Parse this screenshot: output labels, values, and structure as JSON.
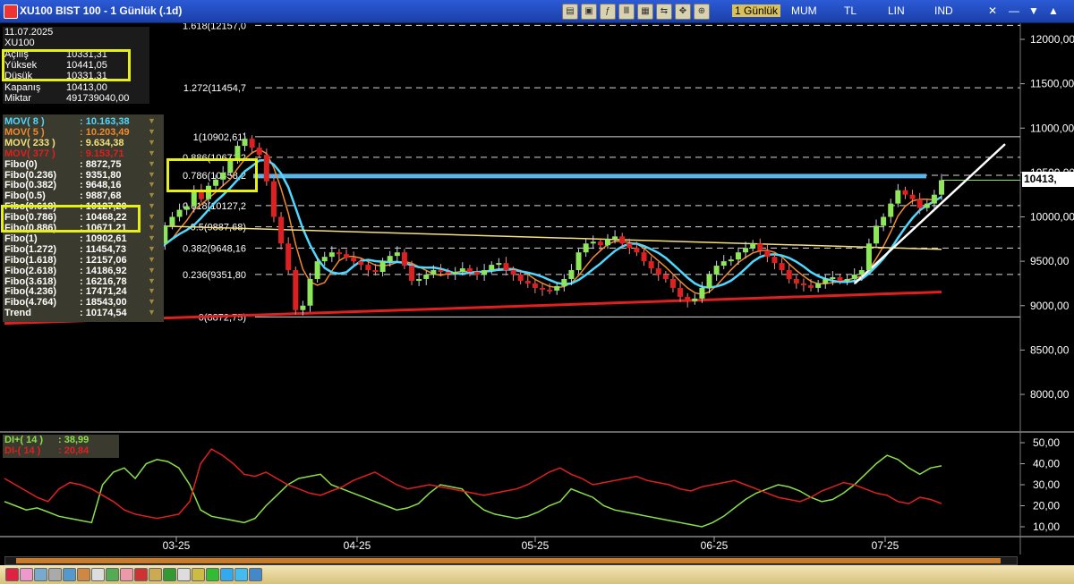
{
  "window": {
    "title": "XU100 BIST 100 - 1 Günlük (.1d)",
    "menu": [
      "1 Günlük",
      "MUM",
      "TL",
      "LIN",
      "IND"
    ],
    "selected_menu": "1 Günlük",
    "last_price_badge": "10413,"
  },
  "info": {
    "date": "11.07.2025",
    "symbol": "XU100",
    "rows": [
      {
        "label": "Açılış",
        "value": "10331,31"
      },
      {
        "label": "Yüksek",
        "value": "10441,05"
      },
      {
        "label": "Düşük",
        "value": "10331,31"
      },
      {
        "label": "Kapanış",
        "value": "10413,00"
      },
      {
        "label": "Miktar",
        "value": "491739040,00"
      }
    ]
  },
  "legend": [
    {
      "label": "MOV( 8 )",
      "value": ": 10.163,38",
      "color": "#4fd8ff"
    },
    {
      "label": "MOV( 5 )",
      "value": ": 10.203,49",
      "color": "#f08a2a"
    },
    {
      "label": "MOV( 233 )",
      "value": ": 9.634,38",
      "color": "#f5e07a"
    },
    {
      "label": "MOV( 377 )",
      "value": ": 9.153,71",
      "color": "#e02020"
    },
    {
      "label": "Fibo(0)",
      "value": ": 8872,75",
      "color": "#ffffff"
    },
    {
      "label": "Fibo(0.236)",
      "value": ": 9351,80",
      "color": "#ffffff"
    },
    {
      "label": "Fibo(0.382)",
      "value": ": 9648,16",
      "color": "#ffffff"
    },
    {
      "label": "Fibo(0.5)",
      "value": ": 9887,68",
      "color": "#ffffff"
    },
    {
      "label": "Fibo(0.618)",
      "value": ": 10127,20",
      "color": "#ffffff"
    },
    {
      "label": "Fibo(0.786)",
      "value": ": 10468,22",
      "color": "#ffffff"
    },
    {
      "label": "Fibo(0.886)",
      "value": ": 10671,21",
      "color": "#ffffff"
    },
    {
      "label": "Fibo(1)",
      "value": ": 10902,61",
      "color": "#ffffff"
    },
    {
      "label": "Fibo(1.272)",
      "value": ": 11454,73",
      "color": "#ffffff"
    },
    {
      "label": "Fibo(1.618)",
      "value": ": 12157,06",
      "color": "#ffffff"
    },
    {
      "label": "Fibo(2.618)",
      "value": ": 14186,92",
      "color": "#ffffff"
    },
    {
      "label": "Fibo(3.618)",
      "value": ": 16216,78",
      "color": "#ffffff"
    },
    {
      "label": "Fibo(4.236)",
      "value": ": 17471,24",
      "color": "#ffffff"
    },
    {
      "label": "Fibo(4.764)",
      "value": ": 18543,00",
      "color": "#ffffff"
    },
    {
      "label": "Trend",
      "value": ": 10174,54",
      "color": "#ffffff"
    }
  ],
  "di_legend": [
    {
      "label": "DI+( 14 )",
      "value": ": 38,99",
      "color": "#8be04a"
    },
    {
      "label": "DI-( 14 )",
      "value": ": 20,84",
      "color": "#e02020"
    }
  ],
  "chart_data": [
    {
      "type": "candlestick",
      "ylim": [
        7600,
        12160
      ],
      "y_ticks": [
        "12000,00",
        "11500,00",
        "11000,00",
        "10500,00",
        "10000,00",
        "9500,00",
        "9000,00",
        "8500,00",
        "8000,00"
      ],
      "x_ticks": [
        "03-25",
        "04-25",
        "05-25",
        "06-25",
        "07-25"
      ],
      "fib_levels": [
        {
          "label": "1.618(12157,0",
          "value": 12157
        },
        {
          "label": "1.272(11454,7",
          "value": 11454.7
        },
        {
          "label": "1(10902,61)",
          "value": 10902.61
        },
        {
          "label": "0.886(10671,2",
          "value": 10671.2
        },
        {
          "label": "0.786(10458,2",
          "value": 10468.2
        },
        {
          "label": "0.618(10127,2",
          "value": 10127.2
        },
        {
          "label": "0.5(9887,68)",
          "value": 9887.68
        },
        {
          "label": "0.382(9648,16",
          "value": 9648.16
        },
        {
          "label": "0.236(9351,80",
          "value": 9351.8
        },
        {
          "label": "0(8872,75)",
          "value": 8872.75
        }
      ],
      "close_series": [
        9540,
        9620,
        9700,
        9900,
        10000,
        10080,
        10120,
        10300,
        10200,
        10350,
        10420,
        10500,
        10650,
        10800,
        10880,
        10780,
        10700,
        10400,
        10000,
        9700,
        9400,
        8950,
        9000,
        9300,
        9500,
        9550,
        9600,
        9580,
        9540,
        9500,
        9460,
        9400,
        9380,
        9500,
        9560,
        9600,
        9450,
        9280,
        9300,
        9350,
        9400,
        9380,
        9360,
        9380,
        9420,
        9380,
        9350,
        9400,
        9460,
        9480,
        9400,
        9350,
        9280,
        9250,
        9200,
        9180,
        9170,
        9220,
        9300,
        9400,
        9600,
        9700,
        9720,
        9680,
        9750,
        9780,
        9700,
        9650,
        9600,
        9500,
        9420,
        9350,
        9300,
        9200,
        9100,
        9050,
        9080,
        9200,
        9350,
        9450,
        9500,
        9520,
        9600,
        9650,
        9700,
        9620,
        9550,
        9480,
        9400,
        9300,
        9250,
        9230,
        9200,
        9250,
        9300,
        9320,
        9280,
        9300,
        9350,
        9400,
        9700,
        9900,
        10000,
        10150,
        10300,
        10250,
        10200,
        10100,
        10150,
        10250,
        10413
      ],
      "mov_377": {
        "start": 8800,
        "end": 9153.71
      },
      "mov_233": {
        "start": 9950,
        "end": 9634.38
      },
      "highlight_level": 10460,
      "trendline": {
        "from": 9250,
        "to": 10820
      }
    },
    {
      "type": "line",
      "ylim": [
        0,
        55
      ],
      "y_ticks": [
        "50,00",
        "40,00",
        "30,00",
        "20,00",
        "10,00"
      ],
      "series": [
        {
          "name": "DI+( 14 )",
          "values": [
            22,
            20,
            18,
            19,
            17,
            15,
            14,
            13,
            12,
            30,
            36,
            38,
            33,
            40,
            42,
            41,
            38,
            30,
            18,
            15,
            14,
            13,
            12,
            14,
            20,
            25,
            30,
            33,
            34,
            35,
            30,
            28,
            26,
            24,
            22,
            20,
            18,
            19,
            21,
            26,
            30,
            29,
            28,
            22,
            18,
            16,
            15,
            14,
            15,
            17,
            20,
            22,
            28,
            26,
            24,
            20,
            18,
            17,
            16,
            15,
            14,
            13,
            12,
            11,
            10,
            12,
            15,
            19,
            23,
            26,
            28,
            30,
            29,
            27,
            24,
            22,
            23,
            26,
            30,
            35,
            40,
            44,
            42,
            38,
            35,
            38,
            39
          ]
        },
        {
          "name": "DI-( 14 )",
          "values": [
            33,
            30,
            27,
            24,
            22,
            28,
            31,
            30,
            28,
            25,
            22,
            18,
            16,
            15,
            14,
            15,
            16,
            22,
            40,
            47,
            44,
            40,
            35,
            34,
            36,
            33,
            30,
            28,
            26,
            25,
            27,
            29,
            32,
            34,
            36,
            33,
            30,
            28,
            29,
            30,
            29,
            28,
            27,
            26,
            25,
            26,
            27,
            28,
            30,
            33,
            36,
            38,
            35,
            33,
            30,
            31,
            32,
            33,
            34,
            32,
            31,
            30,
            28,
            27,
            29,
            30,
            31,
            32,
            30,
            28,
            26,
            24,
            23,
            22,
            24,
            27,
            29,
            31,
            30,
            28,
            26,
            25,
            22,
            21,
            24,
            23,
            21
          ]
        }
      ]
    }
  ]
}
